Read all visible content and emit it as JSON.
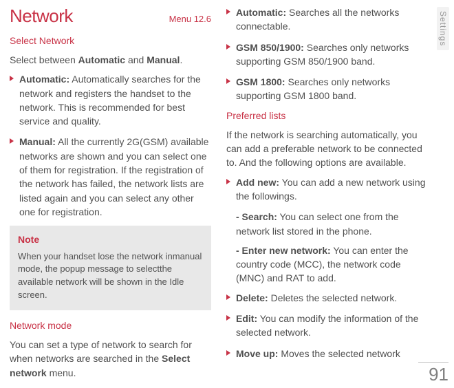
{
  "header": {
    "title": "Network",
    "menu_label": "Menu 12.6"
  },
  "side_tab": "Settings",
  "page_number": "91",
  "left": {
    "select_network_heading": "Select Network",
    "intro_a": "Select between ",
    "intro_bold1": "Automatic",
    "intro_mid": " and ",
    "intro_bold2": "Manual",
    "intro_end": ".",
    "bullets": {
      "automatic": {
        "label": "Automatic:",
        "text": " Automatically searches for the network and registers the handset to the network. This is recommended for best service and quality."
      },
      "manual": {
        "label": "Manual:",
        "text": " All the currently 2G(GSM) available networks are shown and you can select one of them for registration. If the registration of the network has failed, the network lists are listed again and you can select any other one for registration."
      }
    },
    "note": {
      "head": "Note",
      "body": "When your handset lose the network inmanual mode, the popup message to selectthe available network will be shown in the Idle screen."
    },
    "network_mode_heading": "Network mode",
    "network_mode_a": "You can set a type of network to search for when networks are searched in the ",
    "network_mode_bold": "Select network",
    "network_mode_end": " menu."
  },
  "right": {
    "bullets": {
      "automatic": {
        "label": "Automatic:",
        "text": " Searches all the networks connectable."
      },
      "gsm850": {
        "label": "GSM 850/1900:",
        "text": " Searches only networks supporting GSM 850/1900 band."
      },
      "gsm1800": {
        "label": "GSM 1800:",
        "text": " Searches only networks supporting GSM 1800 band."
      }
    },
    "preferred_heading": "Preferred lists",
    "preferred_intro": "If the network is searching automatically, you can add a preferable network to be connected to. And the following options are available.",
    "preferred_bullets": {
      "add_new": {
        "label": "Add new:",
        "text": " You can add a new network using the followings."
      },
      "search": {
        "label": "- Search:",
        "text": " You can select one from the network list stored in the phone."
      },
      "enter_new": {
        "label": "- Enter new network:",
        "text": " You can enter the country code (MCC), the network code (MNC) and RAT to add."
      },
      "delete": {
        "label": "Delete:",
        "text": " Deletes the selected network."
      },
      "edit": {
        "label": "Edit:",
        "text": " You can modify the information of the selected network."
      },
      "move_up": {
        "label": "Move up:",
        "text": " Moves the selected network"
      }
    }
  }
}
